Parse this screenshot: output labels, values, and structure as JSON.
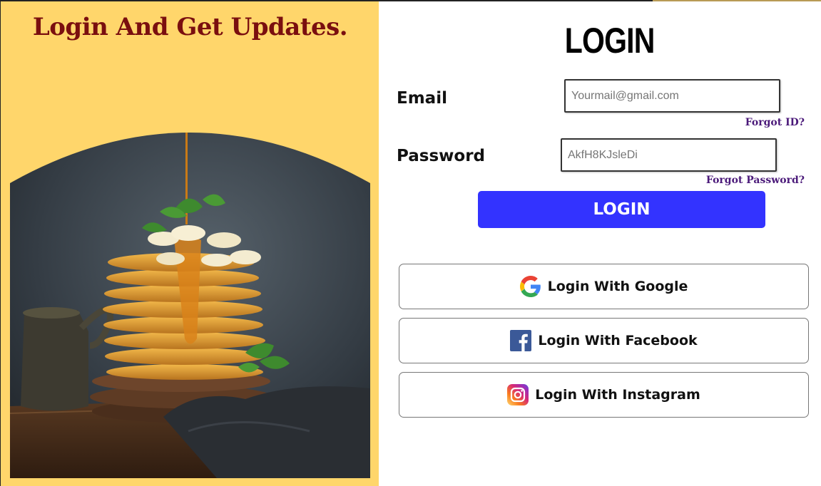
{
  "left_panel": {
    "headline": "Login And Get Updates."
  },
  "form": {
    "title": "LOGIN",
    "email_label": "Email",
    "email_placeholder": "Yourmail@gmail.com",
    "forgot_id": "Forgot ID?",
    "password_label": "Password",
    "password_placeholder": "AkfH8KJsleDi",
    "forgot_password": "Forgot Password?",
    "login_button": "LOGIN"
  },
  "social": {
    "google": {
      "label": "Login With Google",
      "icon": "google-icon"
    },
    "facebook": {
      "label": "Login With Facebook",
      "icon": "facebook-icon"
    },
    "instagram": {
      "label": "Login With Instagram",
      "icon": "instagram-icon"
    }
  },
  "colors": {
    "left_background": "#ffd66b",
    "headline": "#7a0f0f",
    "login_button": "#3333ff",
    "forgot_links": "#4b1a7a",
    "facebook_blue": "#3b5998"
  }
}
